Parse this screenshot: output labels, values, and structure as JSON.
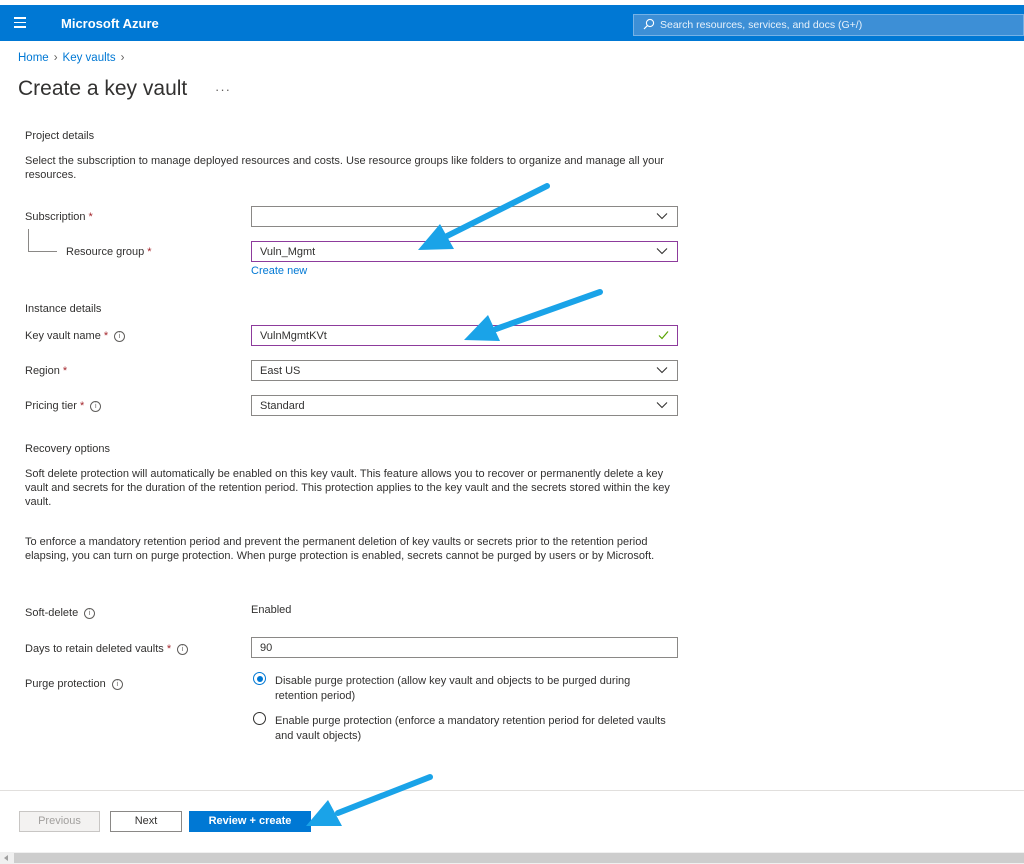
{
  "topbar": {
    "brand": "Microsoft Azure",
    "search_placeholder": "Search resources, services, and docs (G+/)",
    "accent": "#0078d4"
  },
  "breadcrumb": [
    "Home",
    "Key vaults"
  ],
  "page": {
    "title": "Create a key vault",
    "more": "···"
  },
  "project": {
    "heading": "Project details",
    "description": "Select the subscription to manage deployed resources and costs. Use resource groups like folders to organize and manage all your resources.",
    "subscription_label": "Subscription",
    "subscription_value": "",
    "resource_group_label": "Resource group",
    "resource_group_value": "Vuln_Mgmt",
    "create_new": "Create new"
  },
  "instance": {
    "heading": "Instance details",
    "name_label": "Key vault name",
    "name_value": "VulnMgmtKVt",
    "region_label": "Region",
    "region_value": "East US",
    "tier_label": "Pricing tier",
    "tier_value": "Standard"
  },
  "recovery": {
    "heading": "Recovery options",
    "para1": "Soft delete protection will automatically be enabled on this key vault. This feature allows you to recover or permanently delete a key vault and secrets for the duration of the retention period. This protection applies to the key vault and the secrets stored within the key vault.",
    "para2": "To enforce a mandatory retention period and prevent the permanent deletion of key vaults or secrets prior to the retention period elapsing, you can turn on purge protection. When purge protection is enabled, secrets cannot be purged by users or by Microsoft.",
    "soft_delete_label": "Soft-delete",
    "soft_delete_value": "Enabled",
    "days_label": "Days to retain deleted vaults",
    "days_value": "90",
    "purge_label": "Purge protection",
    "purge_options": [
      "Disable purge protection (allow key vault and objects to be purged during retention period)",
      "Enable purge protection (enforce a mandatory retention period for deleted vaults and vault objects)"
    ],
    "purge_selected": 0
  },
  "footer": {
    "previous": "Previous",
    "next": "Next",
    "review": "Review + create"
  },
  "annotation_color": "#1aa3e8"
}
